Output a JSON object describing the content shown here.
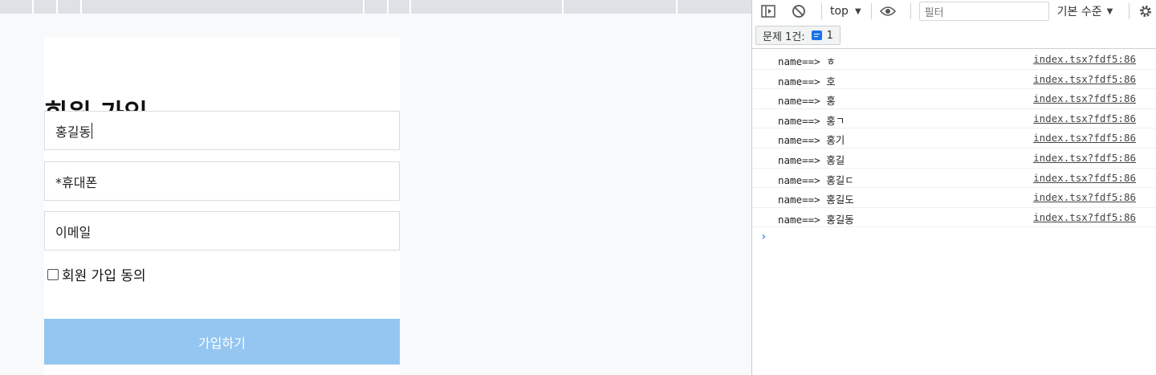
{
  "form": {
    "title": "회원 가입",
    "name_value": "홍길동",
    "phone_placeholder": "*휴대폰",
    "email_placeholder": "이메일",
    "agree_label": "회원 가입 동의",
    "submit_label": "가입하기",
    "submit_color": "#94c6f1"
  },
  "devtools": {
    "context": "top",
    "filter_placeholder": "필터",
    "levels": "기본 수준",
    "issues_label": "문제 1건:",
    "issues_count": "1",
    "logs": [
      {
        "msg": "name==> ㅎ",
        "src": "index.tsx?fdf5:86"
      },
      {
        "msg": "name==> 호",
        "src": "index.tsx?fdf5:86"
      },
      {
        "msg": "name==> 홍",
        "src": "index.tsx?fdf5:86"
      },
      {
        "msg": "name==> 홍ㄱ",
        "src": "index.tsx?fdf5:86"
      },
      {
        "msg": "name==> 홍기",
        "src": "index.tsx?fdf5:86"
      },
      {
        "msg": "name==> 홍길",
        "src": "index.tsx?fdf5:86"
      },
      {
        "msg": "name==> 홍길ㄷ",
        "src": "index.tsx?fdf5:86"
      },
      {
        "msg": "name==> 홍길도",
        "src": "index.tsx?fdf5:86"
      },
      {
        "msg": "name==> 홍길동",
        "src": "index.tsx?fdf5:86"
      }
    ],
    "prompt_glyph": "›"
  }
}
